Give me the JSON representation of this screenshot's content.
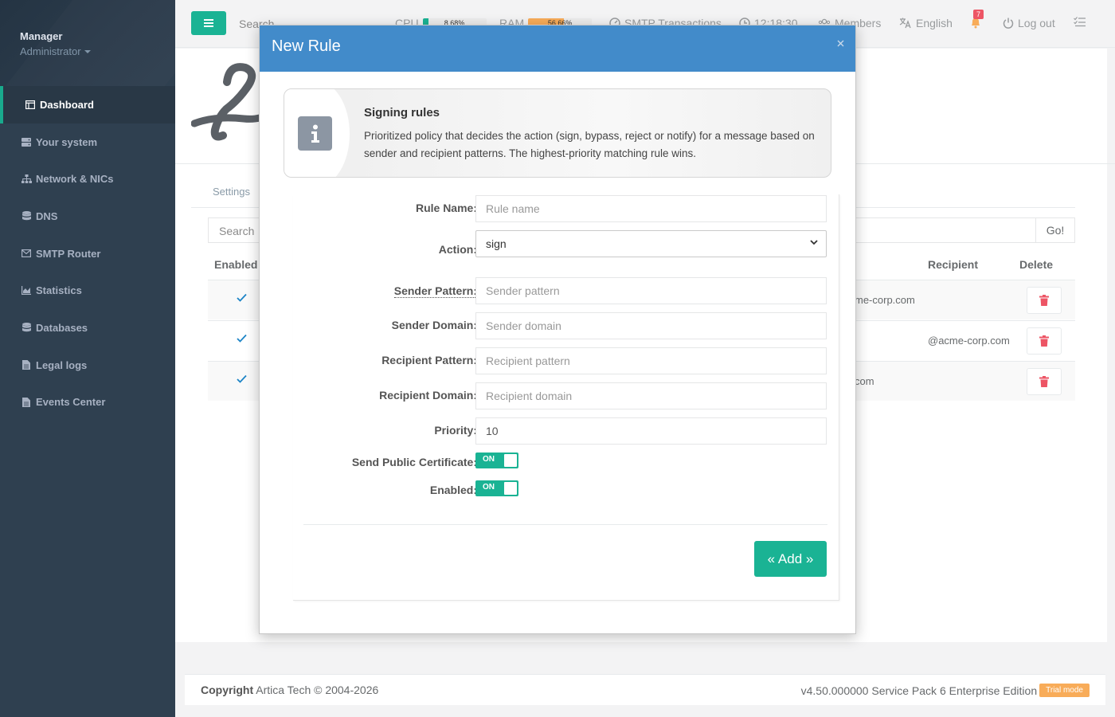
{
  "sidebar": {
    "profile": {
      "name": "Manager",
      "role": "Administrator"
    },
    "items": [
      {
        "label": "Dashboard",
        "icon": "dashboard-icon"
      },
      {
        "label": "Your system",
        "icon": "server-icon"
      },
      {
        "label": "Network & NICs",
        "icon": "sitemap-icon"
      },
      {
        "label": "DNS",
        "icon": "database-icon"
      },
      {
        "label": "SMTP Router",
        "icon": "envelope-icon"
      },
      {
        "label": "Statistics",
        "icon": "chart-icon"
      },
      {
        "label": "Databases",
        "icon": "database-icon"
      },
      {
        "label": "Legal logs",
        "icon": "file-icon"
      },
      {
        "label": "Events Center",
        "icon": "file-icon"
      }
    ]
  },
  "topbar": {
    "search_placeholder": "Search",
    "cpu_label": "CPU",
    "cpu_value": "8.68%",
    "cpu_fraction": 0.0868,
    "ram_label": "RAM",
    "ram_value": "56.66%",
    "ram_fraction": 0.5666,
    "smtp_label": "SMTP Transactions",
    "time": "12:18:30",
    "members_label": "Members",
    "language": "English",
    "notifications_count": "7",
    "logout_label": "Log out"
  },
  "background": {
    "tab_settings": "Settings",
    "search_placeholder": "Search",
    "go_label": "Go!",
    "columns": {
      "enabled": "Enabled",
      "recipient": "Recipient",
      "delete": "Delete"
    },
    "rows": [
      {
        "partial_text": "me-corp.com",
        "recipient": ""
      },
      {
        "partial_text": "",
        "recipient": "@acme-corp.com"
      },
      {
        "partial_text": "com",
        "recipient": ""
      }
    ]
  },
  "modal": {
    "title": "New Rule",
    "info": {
      "title": "Signing rules",
      "text": "Prioritized policy that decides the action (sign, bypass, reject or notify) for a message based on sender and recipient patterns. The highest-priority matching rule wins."
    },
    "form": {
      "rule_name_label": "Rule Name:",
      "rule_name_placeholder": "Rule name",
      "action_label": "Action:",
      "action_value": "sign",
      "sender_pattern_label": "Sender Pattern:",
      "sender_pattern_placeholder": "Sender pattern",
      "sender_domain_label": "Sender Domain:",
      "sender_domain_placeholder": "Sender domain",
      "recipient_pattern_label": "Recipient Pattern:",
      "recipient_pattern_placeholder": "Recipient pattern",
      "recipient_domain_label": "Recipient Domain:",
      "recipient_domain_placeholder": "Recipient domain",
      "priority_label": "Priority:",
      "priority_value": "10",
      "send_cert_label": "Send Public Certificate:",
      "send_cert_state": "ON",
      "enabled_label": "Enabled:",
      "enabled_state": "ON",
      "add_label": "« Add »"
    }
  },
  "footer": {
    "copyright_label": "Copyright",
    "copyright_text": "Artica Tech © 2004-2026",
    "version": "v4.50.000000 Service Pack 6 Enterprise Edition",
    "trial_badge": "Trial mode"
  },
  "colors": {
    "sidebar_bg": "#2f4050",
    "accent_green": "#1ab394",
    "modal_header": "#428bca",
    "danger_red": "#ed5565",
    "cpu_bar": "#1ab394",
    "ram_bar": "#f8ac59",
    "trial": "#f8ac59"
  }
}
